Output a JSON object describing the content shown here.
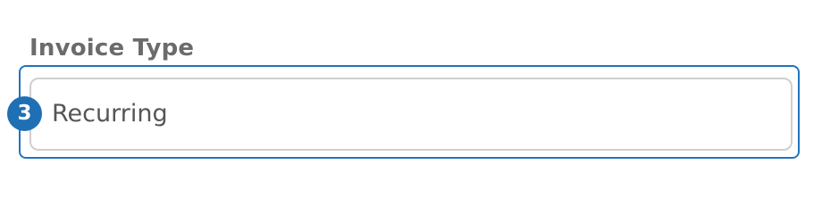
{
  "field": {
    "label": "Invoice Type",
    "value": "Recurring"
  },
  "step_badge": {
    "number": "3"
  },
  "colors": {
    "accent": "#2274be",
    "badge": "#1f6fb5",
    "label_text": "#6b6b6b",
    "value_text": "#555555",
    "input_border": "#cfcfcf"
  }
}
